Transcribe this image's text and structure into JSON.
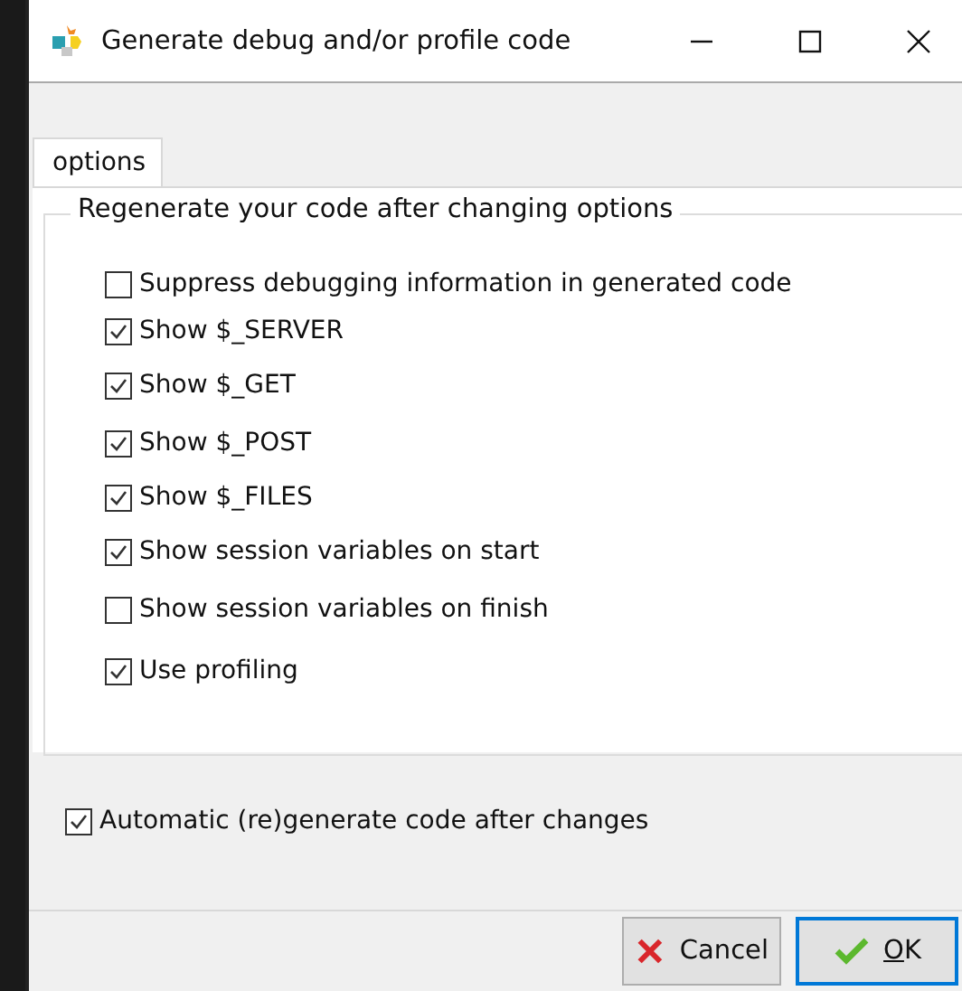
{
  "window": {
    "title": "Generate debug and/or profile code"
  },
  "tabs": [
    {
      "label": "options",
      "selected": true
    }
  ],
  "group": {
    "title": "Regenerate your code after changing options",
    "options": [
      {
        "label": "Suppress debugging information in generated code",
        "checked": false
      },
      {
        "label": "Show $_SERVER",
        "checked": true
      },
      {
        "label": "Show $_GET",
        "checked": true
      },
      {
        "label": "Show $_POST",
        "checked": true
      },
      {
        "label": "Show $_FILES",
        "checked": true
      },
      {
        "label": "Show session variables on start",
        "checked": true
      },
      {
        "label": "Show session variables on finish",
        "checked": false
      },
      {
        "label": "Use profiling",
        "checked": true
      }
    ]
  },
  "auto_regenerate": {
    "label": "Automatic (re)generate code after changes",
    "checked": true
  },
  "buttons": [
    {
      "label": "Cancel",
      "kind": "cancel"
    },
    {
      "label": "OK",
      "kind": "ok"
    }
  ]
}
